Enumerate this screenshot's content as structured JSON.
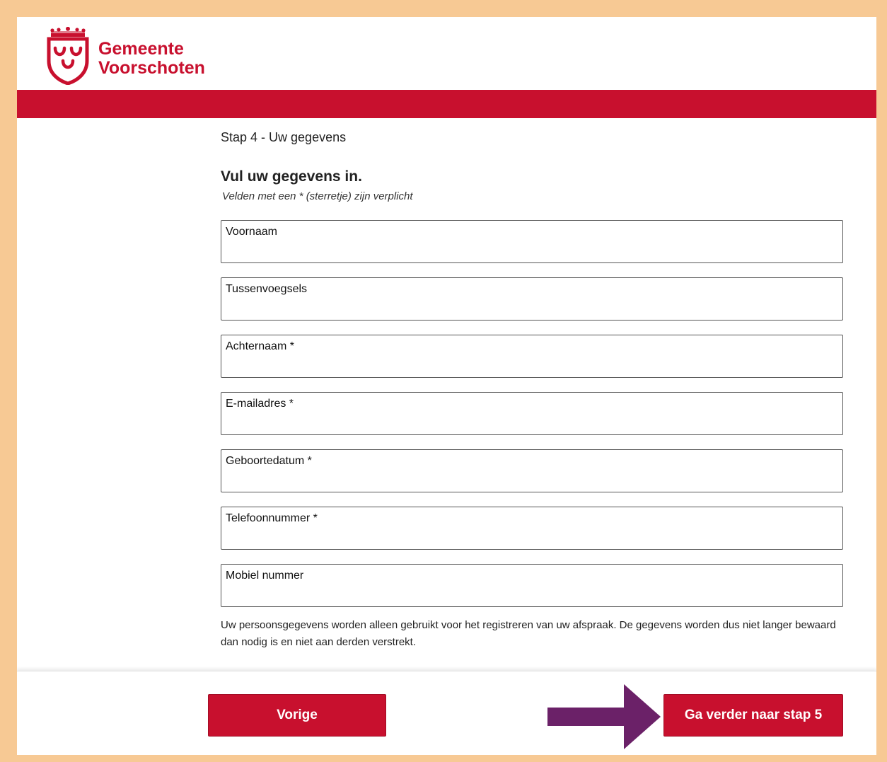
{
  "brand": {
    "name_line1": "Gemeente",
    "name_line2": "Voorschoten",
    "color": "#c8102e"
  },
  "step_label": "Stap 4 - Uw gegevens",
  "form": {
    "title": "Vul uw gegevens in.",
    "required_note": "Velden met een * (sterretje) zijn verplicht",
    "fields": [
      {
        "label": "Voornaam",
        "value": ""
      },
      {
        "label": "Tussenvoegsels",
        "value": ""
      },
      {
        "label": "Achternaam *",
        "value": ""
      },
      {
        "label": "E-mailadres *",
        "value": ""
      },
      {
        "label": "Geboortedatum *",
        "value": ""
      },
      {
        "label": "Telefoonnummer *",
        "value": ""
      },
      {
        "label": "Mobiel nummer",
        "value": ""
      }
    ],
    "privacy_text": "Uw persoonsgegevens worden alleen gebruikt voor het registreren van uw afspraak. De gegevens worden dus niet langer bewaard dan nodig is en niet aan derden verstrekt."
  },
  "footer": {
    "prev_label": "Vorige",
    "next_label": "Ga verder naar stap 5",
    "arrow_color": "#6b2168"
  },
  "page_border_color": "#f7c994"
}
